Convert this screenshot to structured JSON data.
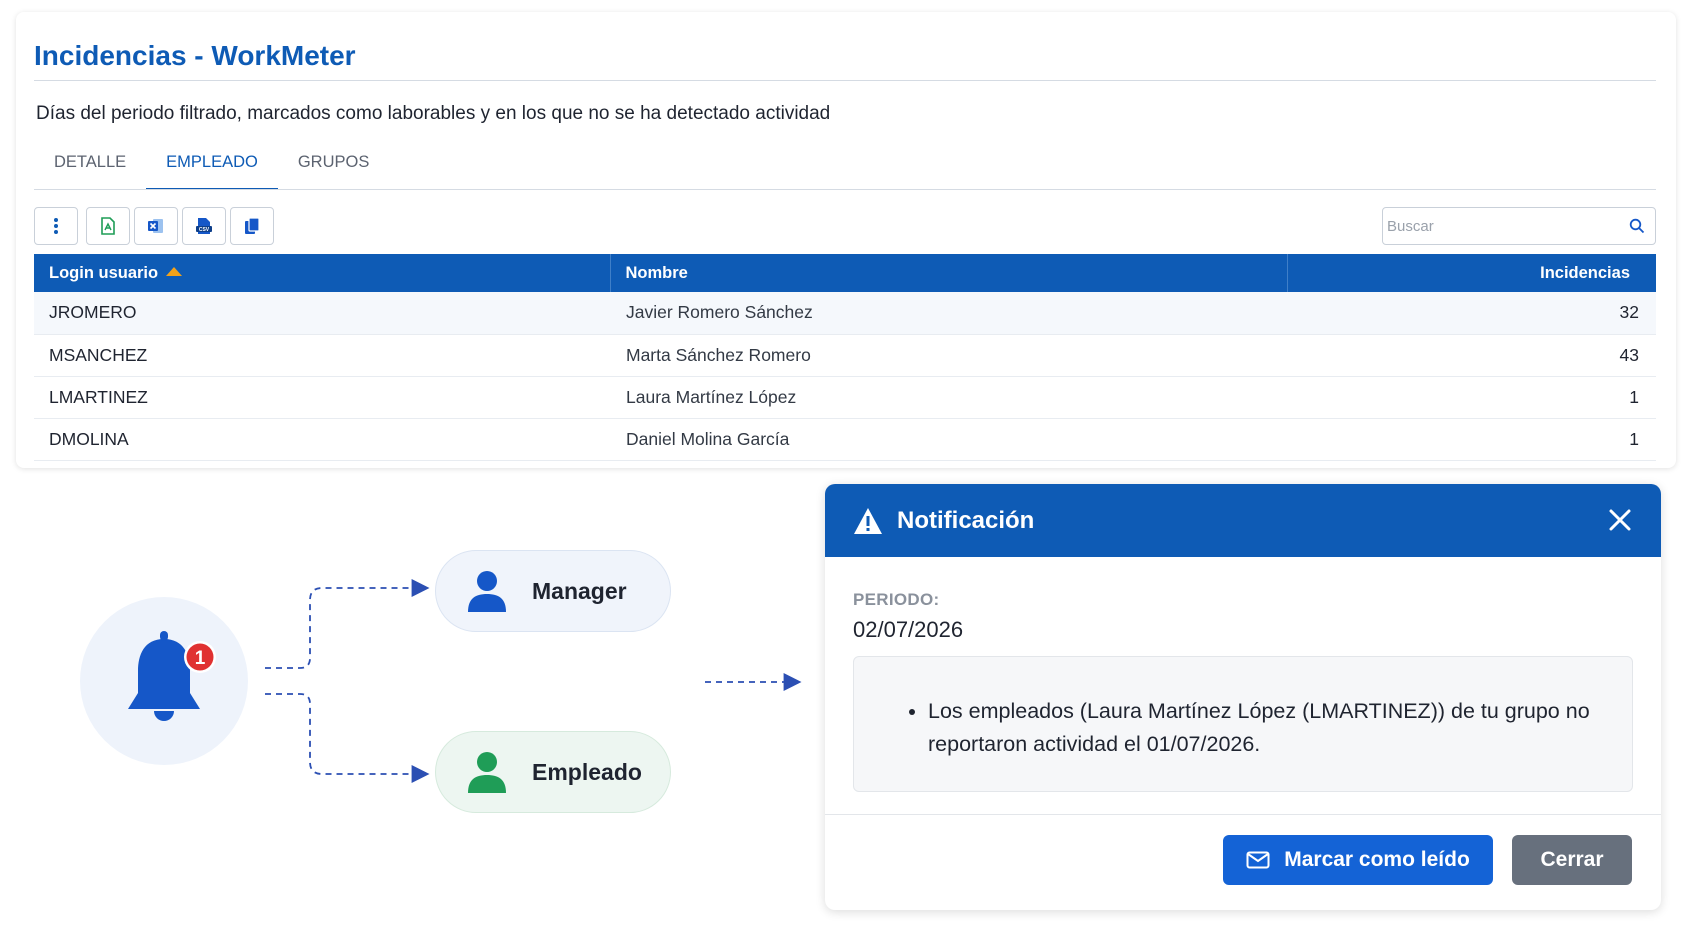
{
  "header": {
    "title": "Incidencias - WorkMeter",
    "description": "Días del periodo filtrado, marcados como laborables y en los que no se ha detectado actividad"
  },
  "tabs": [
    {
      "label": "DETALLE",
      "active": false
    },
    {
      "label": "EMPLEADO",
      "active": true
    },
    {
      "label": "GRUPOS",
      "active": false
    }
  ],
  "toolbar": {
    "buttons": [
      "more-options-icon",
      "pdf-export-icon",
      "excel-export-icon",
      "csv-export-icon",
      "copy-icon"
    ]
  },
  "search": {
    "placeholder": "Buscar"
  },
  "table": {
    "columns": [
      "Login usuario",
      "Nombre",
      "Incidencias"
    ],
    "sort": {
      "column": "Login usuario",
      "direction": "asc"
    },
    "rows": [
      {
        "login": "JROMERO",
        "nombre": "Javier Romero Sánchez",
        "incidencias": "32"
      },
      {
        "login": "MSANCHEZ",
        "nombre": "Marta Sánchez Romero",
        "incidencias": "43"
      },
      {
        "login": "LMARTINEZ",
        "nombre": "Laura Martínez López",
        "incidencias": "1"
      },
      {
        "login": "DMOLINA",
        "nombre": "Daniel Molina García",
        "incidencias": "1"
      }
    ]
  },
  "diagram": {
    "badge_count": "1",
    "recipients": [
      {
        "label": "Manager",
        "color": "#1557c8"
      },
      {
        "label": "Empleado",
        "color": "#1f9d57"
      }
    ]
  },
  "notification": {
    "title": "Notificación",
    "periodo_label": "PERIODO:",
    "periodo_value": "02/07/2026",
    "message": "Los empleados (Laura Martínez López (LMARTINEZ)) de tu grupo no reportaron actividad el 01/07/2026.",
    "mark_read_label": "Marcar como leído",
    "close_label": "Cerrar"
  },
  "colors": {
    "primary": "#0e5bb5",
    "button_primary": "#1463d6",
    "button_secondary": "#67707d",
    "sort_arrow": "#f2a21a",
    "badge": "#e03131"
  }
}
